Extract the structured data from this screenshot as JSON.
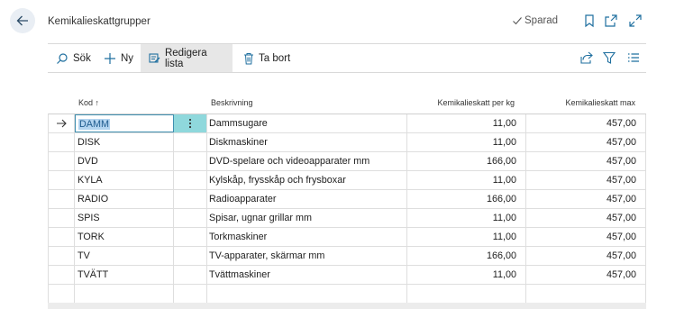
{
  "header": {
    "title": "Kemikalieskattgrupper",
    "saved_label": "Sparad"
  },
  "toolbar": {
    "search_label": "Sök",
    "new_label": "Ny",
    "edit_label": "Redigera lista",
    "delete_label": "Ta bort"
  },
  "table": {
    "columns": [
      "Kod ↑",
      "Beskrivning",
      "Kemikalieskatt per kg",
      "Kemikalieskatt max"
    ],
    "rows": [
      {
        "kod": "DAMM",
        "beskrivning": "Dammsugare",
        "per_kg": "11,00",
        "max": "457,00"
      },
      {
        "kod": "DISK",
        "beskrivning": "Diskmaskiner",
        "per_kg": "11,00",
        "max": "457,00"
      },
      {
        "kod": "DVD",
        "beskrivning": "DVD-spelare och videoapparater mm",
        "per_kg": "166,00",
        "max": "457,00"
      },
      {
        "kod": "KYLA",
        "beskrivning": "Kylskåp, frysskåp och frysboxar",
        "per_kg": "11,00",
        "max": "457,00"
      },
      {
        "kod": "RADIO",
        "beskrivning": "Radioapparater",
        "per_kg": "166,00",
        "max": "457,00"
      },
      {
        "kod": "SPIS",
        "beskrivning": "Spisar, ugnar grillar mm",
        "per_kg": "11,00",
        "max": "457,00"
      },
      {
        "kod": "TORK",
        "beskrivning": "Torkmaskiner",
        "per_kg": "11,00",
        "max": "457,00"
      },
      {
        "kod": "TV",
        "beskrivning": "TV-apparater, skärmar mm",
        "per_kg": "166,00",
        "max": "457,00"
      },
      {
        "kod": "TVÄTT",
        "beskrivning": "Tvättmaskiner",
        "per_kg": "11,00",
        "max": "457,00"
      }
    ]
  },
  "icons": {
    "back": "arrow-left-icon",
    "saved": "checkmark-icon",
    "bookmark": "bookmark-icon",
    "open_new": "open-in-new-window-icon",
    "expand": "expand-icon",
    "search": "search-icon",
    "new": "plus-icon",
    "edit": "edit-list-icon",
    "delete": "trash-icon",
    "share": "share-icon",
    "filter": "filter-icon",
    "list": "list-view-icon",
    "row_arrow": "arrow-right-icon",
    "row_menu": "vertical-ellipsis-icon"
  },
  "colors": {
    "accent": "#1f6f9f",
    "selected_cell_border": "#3f8fb0",
    "row_menu_bg": "#8fd8dc",
    "toolbar_active_bg": "#e7e7e7"
  }
}
